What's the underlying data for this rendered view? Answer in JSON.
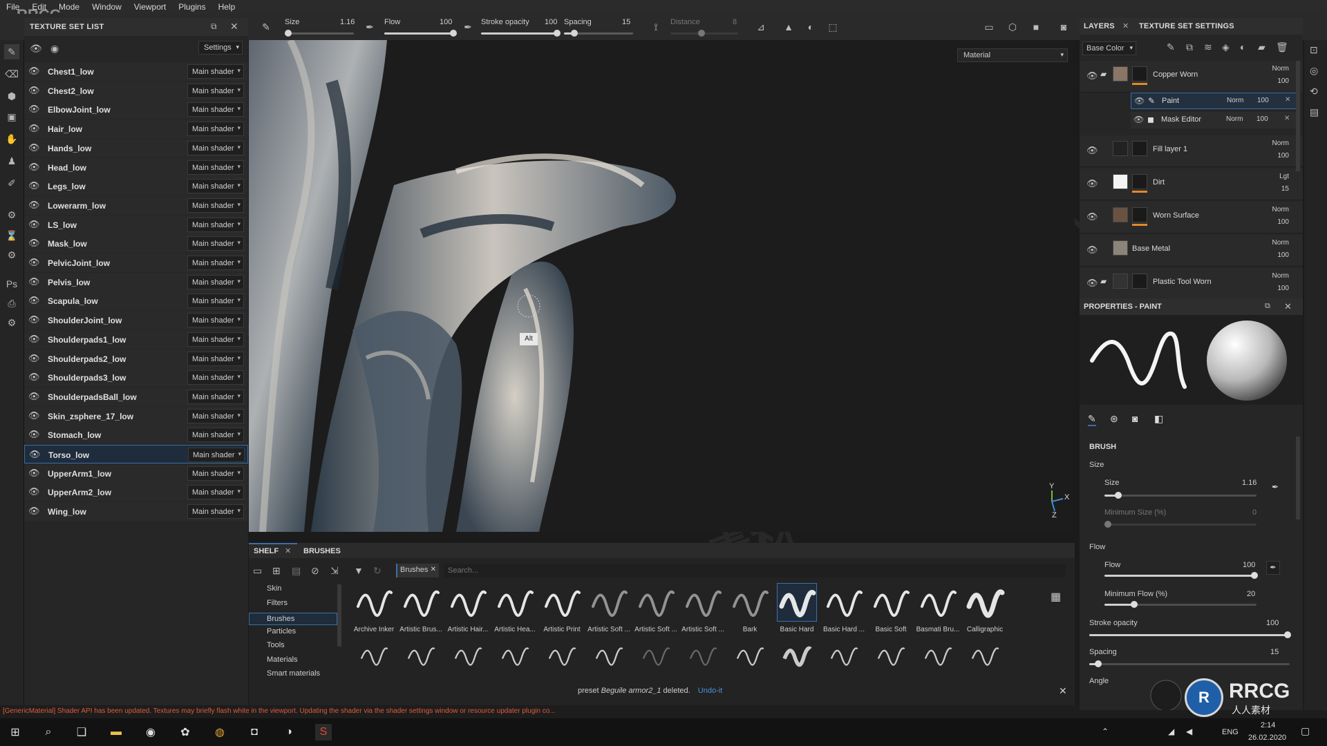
{
  "menu": [
    "File",
    "Edit",
    "Mode",
    "Window",
    "Viewport",
    "Plugins",
    "Help"
  ],
  "toolbar": {
    "size_label": "Size",
    "size_value": "1.16",
    "flow_label": "Flow",
    "flow_value": "100",
    "stroke_opacity_label": "Stroke opacity",
    "stroke_opacity_value": "100",
    "spacing_label": "Spacing",
    "spacing_value": "15",
    "distance_label": "Distance",
    "distance_value": "8",
    "size_fraction": 0.03,
    "flow_fraction": 1.0,
    "stroke_opacity_fraction": 1.0,
    "spacing_fraction": 0.15
  },
  "texture_set_list": {
    "title": "TEXTURE SET LIST",
    "settings_label": "Settings",
    "items": [
      {
        "name": "Chest1_low",
        "shader": "Main shader"
      },
      {
        "name": "Chest2_low",
        "shader": "Main shader"
      },
      {
        "name": "ElbowJoint_low",
        "shader": "Main shader"
      },
      {
        "name": "Hair_low",
        "shader": "Main shader"
      },
      {
        "name": "Hands_low",
        "shader": "Main shader"
      },
      {
        "name": "Head_low",
        "shader": "Main shader"
      },
      {
        "name": "Legs_low",
        "shader": "Main shader"
      },
      {
        "name": "Lowerarm_low",
        "shader": "Main shader"
      },
      {
        "name": "LS_low",
        "shader": "Main shader"
      },
      {
        "name": "Mask_low",
        "shader": "Main shader"
      },
      {
        "name": "PelvicJoint_low",
        "shader": "Main shader"
      },
      {
        "name": "Pelvis_low",
        "shader": "Main shader"
      },
      {
        "name": "Scapula_low",
        "shader": "Main shader"
      },
      {
        "name": "ShoulderJoint_low",
        "shader": "Main shader"
      },
      {
        "name": "Shoulderpads1_low",
        "shader": "Main shader"
      },
      {
        "name": "Shoulderpads2_low",
        "shader": "Main shader"
      },
      {
        "name": "Shoulderpads3_low",
        "shader": "Main shader"
      },
      {
        "name": "ShoulderpadsBall_low",
        "shader": "Main shader"
      },
      {
        "name": "Skin_zsphere_17_low",
        "shader": "Main shader"
      },
      {
        "name": "Stomach_low",
        "shader": "Main shader"
      },
      {
        "name": "Torso_low",
        "shader": "Main shader",
        "selected": true
      },
      {
        "name": "UpperArm1_low",
        "shader": "Main shader"
      },
      {
        "name": "UpperArm2_low",
        "shader": "Main shader"
      },
      {
        "name": "Wing_low",
        "shader": "Main shader"
      }
    ]
  },
  "viewport": {
    "material_mode": "Material",
    "alt_tooltip": "Alt",
    "axis": {
      "y": "Y",
      "x": "X",
      "z": "Z"
    }
  },
  "shelf": {
    "tabs": [
      "SHELF",
      "BRUSHES"
    ],
    "filter_chip": "Brushes",
    "search_placeholder": "Search...",
    "categories": [
      "Skin",
      "Filters",
      "Brushes",
      "Particles",
      "Tools",
      "Materials",
      "Smart materials"
    ],
    "selected_category": "Brushes",
    "brushes": [
      "Archive Inker",
      "Artistic Brus...",
      "Artistic Hair...",
      "Artistic Hea...",
      "Artistic Print",
      "Artistic Soft ...",
      "Artistic Soft ...",
      "Artistic Soft ...",
      "Bark",
      "Basic Hard",
      "Basic Hard ...",
      "Basic Soft",
      "Basmati Bru...",
      "Calligraphic"
    ],
    "selected_brush": "Basic Hard",
    "notice_text": "preset",
    "notice_preset": "Beguile armor2_1",
    "notice_suffix": "deleted.",
    "undo_link": "Undo-it"
  },
  "status_message": "[GenericMaterial] Shader API has been updated. Textures may briefly flash white in the viewport. Updating the shader via the shader settings window or resource updater plugin co...",
  "layers_panel": {
    "tabs": [
      "LAYERS",
      "TEXTURE SET SETTINGS"
    ],
    "channel": "Base Color",
    "layers": [
      {
        "name": "Copper Worn",
        "blend": "Norm",
        "opacity": "100",
        "folder": true
      },
      {
        "name": "Fill layer 1",
        "blend": "Norm",
        "opacity": "100"
      },
      {
        "name": "Dirt",
        "blend": "Lgt",
        "opacity": "15"
      },
      {
        "name": "Worn Surface",
        "blend": "Norm",
        "opacity": "100"
      },
      {
        "name": "Base Metal",
        "blend": "Norm",
        "opacity": "100"
      },
      {
        "name": "Plastic Tool Worn",
        "blend": "Norm",
        "opacity": "100",
        "folder": true
      }
    ],
    "sublayers": [
      {
        "name": "Paint",
        "blend": "Norm",
        "opacity": "100",
        "selected": true
      },
      {
        "name": "Mask Editor",
        "blend": "Norm",
        "opacity": "100"
      }
    ]
  },
  "properties": {
    "title": "PROPERTIES - PAINT",
    "brush_section": "BRUSH",
    "size_group": "Size",
    "size_label": "Size",
    "size_value": "1.16",
    "min_size_label": "Minimum Size (%)",
    "min_size_value": "0",
    "flow_group": "Flow",
    "flow_label": "Flow",
    "flow_value": "100",
    "min_flow_label": "Minimum Flow (%)",
    "min_flow_value": "20",
    "stroke_opacity_label": "Stroke opacity",
    "stroke_opacity_value": "100",
    "spacing_label": "Spacing",
    "spacing_value": "15",
    "angle_label": "Angle"
  },
  "taskbar": {
    "lang": "ENG",
    "time": "2:14",
    "date": "26.02.2020"
  },
  "watermark": {
    "logo_text": "RRCG",
    "cn_text": "人人素材",
    "corner_cn": "人人素材"
  },
  "colors": {
    "accent": "#3d6fa8",
    "layer_bar": "#e28a2a",
    "status_text": "#e05a3a"
  }
}
